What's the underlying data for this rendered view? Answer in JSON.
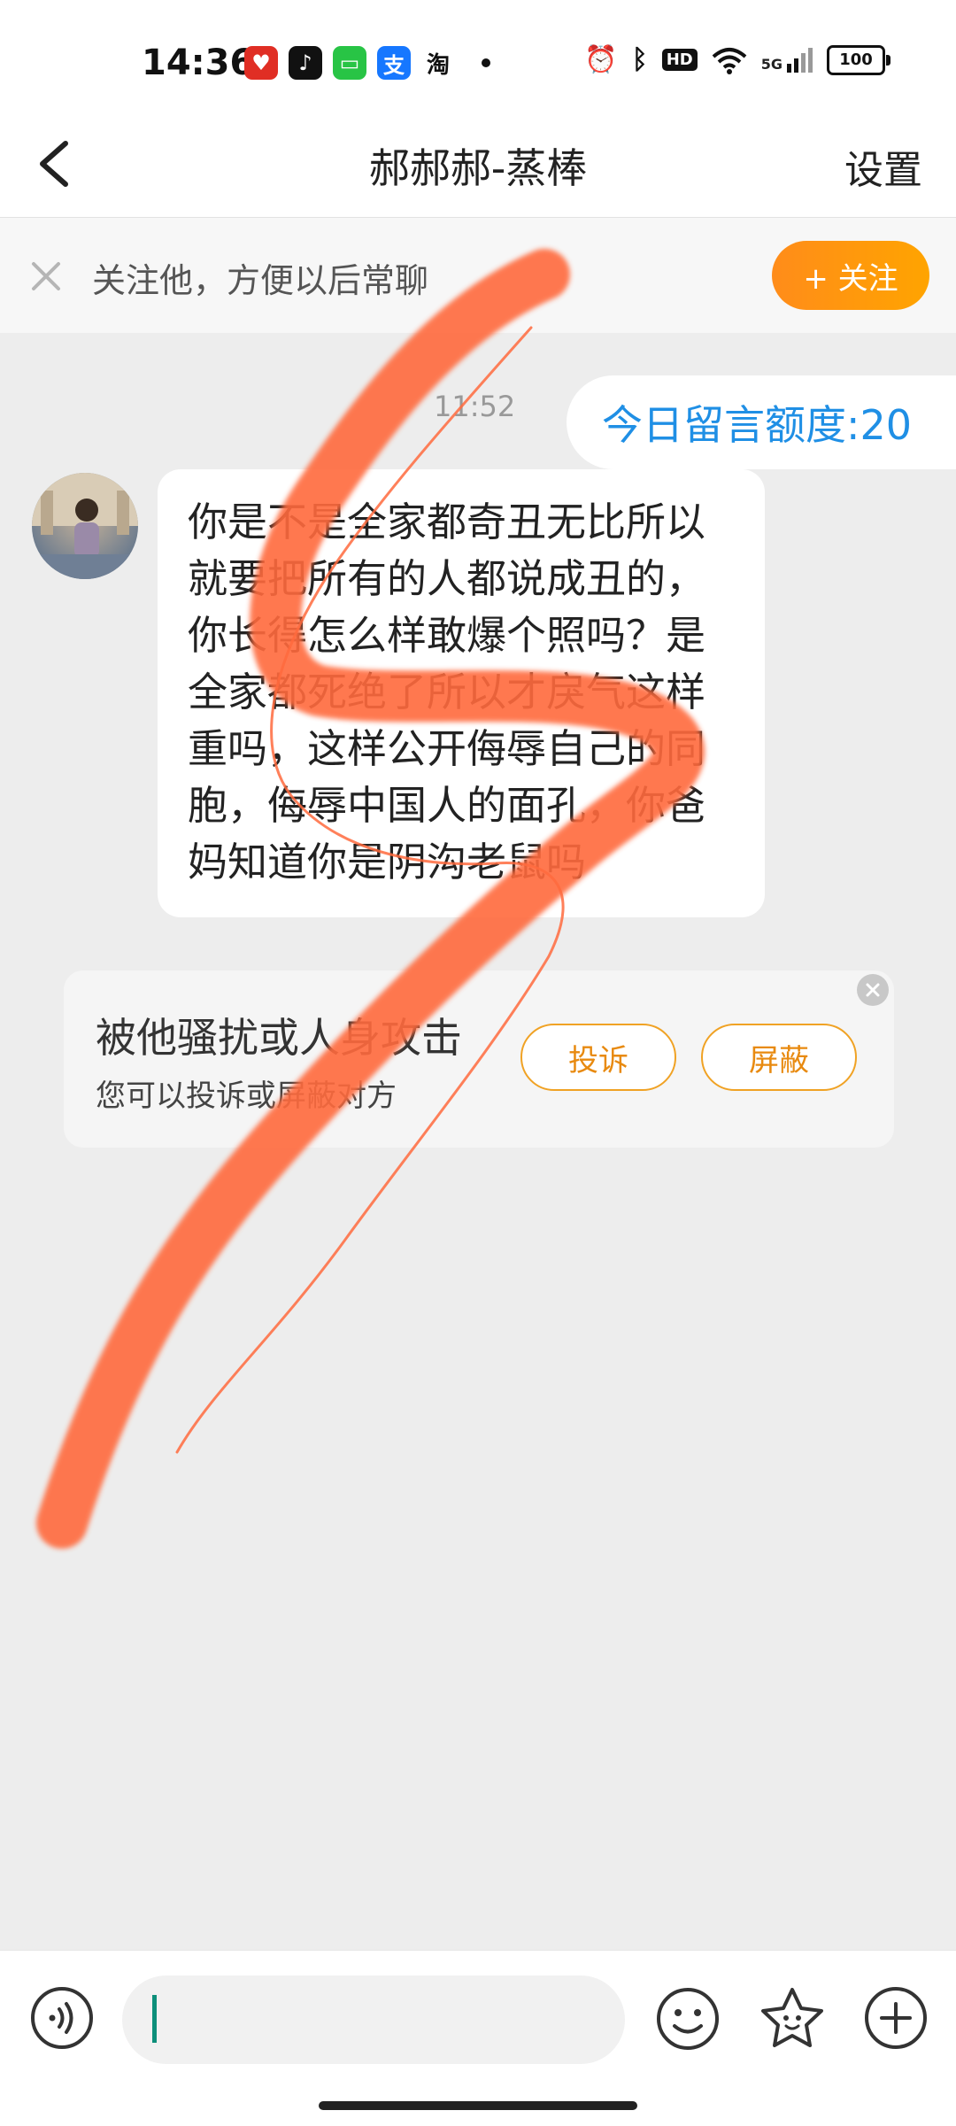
{
  "status_bar": {
    "time": "14:36",
    "app_icons": [
      {
        "icon": "pinduoduo-icon",
        "glyph": "♥",
        "color": "#e02e24"
      },
      {
        "icon": "douyin-icon",
        "glyph": "♪",
        "color": "#111111"
      },
      {
        "icon": "messages-icon",
        "glyph": "▭",
        "color": "#28c445"
      },
      {
        "icon": "alipay-icon",
        "glyph": "支",
        "color": "#1677ff"
      },
      {
        "icon": "taobao-icon",
        "glyph": "淘",
        "color": "#ff5000"
      }
    ],
    "hd_label": "HD",
    "signal_label": "5G",
    "battery": "100"
  },
  "nav": {
    "title": "郝郝郝-蒸棒",
    "settings_label": "设置"
  },
  "follow_bar": {
    "prompt": "关注他，方便以后常聊",
    "button_label": "+ 关注"
  },
  "chat": {
    "timestamp": "11:52",
    "quota_text": "今日留言额度:20",
    "message": "你是不是全家都奇丑无比所以就要把所有的人都说成丑的，你长得怎么样敢爆个照吗？是全家都死绝了所以才戾气这样重吗，这样公开侮辱自己的同胞，侮辱中国人的面孔，你爸妈知道你是阴沟老鼠吗"
  },
  "report_card": {
    "title": "被他骚扰或人身攻击",
    "subtitle": "您可以投诉或屏蔽对方",
    "complain_label": "投诉",
    "block_label": "屏蔽"
  },
  "input_bar": {
    "placeholder": ""
  },
  "colors": {
    "accent_orange": "#ff9a14",
    "quota_blue": "#1f8fe5",
    "scribble": "#ff6a3d"
  }
}
